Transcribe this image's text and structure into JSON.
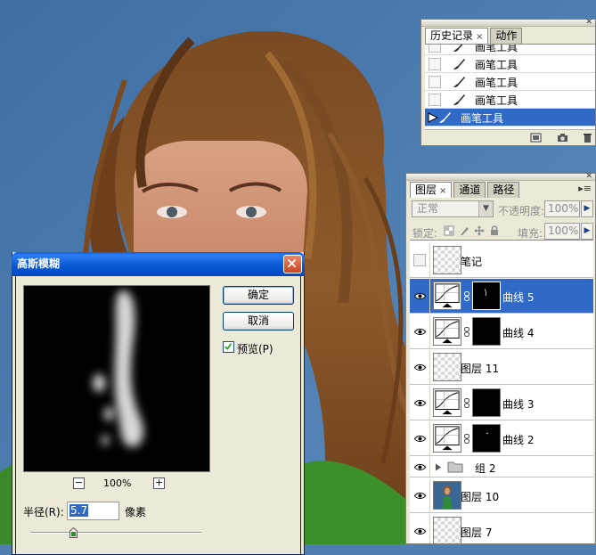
{
  "colors": {
    "sky_blue": "#4f7fb0",
    "panel_bg": "#ece9d8",
    "selection_blue": "#3169c6",
    "dialog_title": "#0a5ad6"
  },
  "history": {
    "tabs": [
      {
        "label": "历史记录",
        "active": true
      },
      {
        "label": "动作",
        "active": false
      }
    ],
    "close_symbol": "×",
    "items": [
      {
        "label": "画笔工具",
        "selected": false
      },
      {
        "label": "画笔工具",
        "selected": false
      },
      {
        "label": "画笔工具",
        "selected": false
      },
      {
        "label": "画笔工具",
        "selected": false
      },
      {
        "label": "画笔工具",
        "selected": true
      }
    ]
  },
  "layers": {
    "tabs": [
      {
        "label": "图层",
        "active": true
      },
      {
        "label": "通道",
        "active": false
      },
      {
        "label": "路径",
        "active": false
      }
    ],
    "close_symbol": "×",
    "blend_mode": "正常",
    "opacity_label": "不透明度:",
    "opacity_value": "100%",
    "lock_label": "锁定:",
    "fill_label": "填充:",
    "fill_value": "100%",
    "rows": [
      {
        "name": "笔记",
        "kind": "transparent",
        "visible": false,
        "selected": false
      },
      {
        "name": "曲线 5",
        "kind": "curves",
        "visible": true,
        "selected": true
      },
      {
        "name": "曲线 4",
        "kind": "curves",
        "visible": true,
        "selected": false
      },
      {
        "name": "图层 11",
        "kind": "transparent",
        "visible": true,
        "selected": false
      },
      {
        "name": "曲线 3",
        "kind": "curves",
        "visible": true,
        "selected": false
      },
      {
        "name": "曲线 2",
        "kind": "curves",
        "visible": true,
        "selected": false
      },
      {
        "name": "组 2",
        "kind": "group",
        "visible": true,
        "selected": false
      },
      {
        "name": "图层 10",
        "kind": "photo",
        "visible": true,
        "selected": false
      },
      {
        "name": "图层 7",
        "kind": "transparent",
        "visible": true,
        "selected": false
      }
    ]
  },
  "dialog": {
    "title": "高斯模糊",
    "ok_label": "确定",
    "cancel_label": "取消",
    "preview_label": "预览(P)",
    "preview_checked": true,
    "zoom_out": "−",
    "zoom_in": "+",
    "zoom_level": "100%",
    "radius_label": "半径(R):",
    "radius_value": "5.7",
    "radius_unit": "像素",
    "radius_slider_fraction": 0.25
  }
}
